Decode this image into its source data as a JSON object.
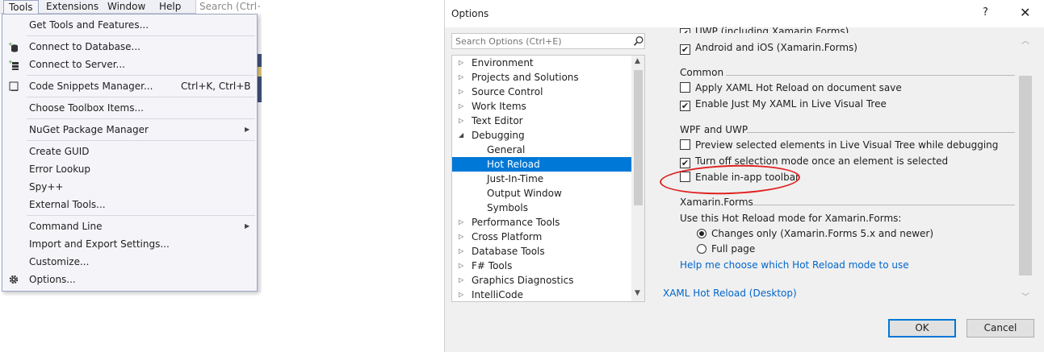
{
  "menubar": {
    "items": [
      "Tools",
      "Extensions",
      "Window",
      "Help"
    ],
    "search_placeholder": "Search (Ctrl+Q)"
  },
  "tools_menu": {
    "items": [
      {
        "label": "Get Tools and Features...",
        "shortcut": "",
        "icon": "",
        "submenu": false
      },
      {
        "label": "Connect to Database...",
        "shortcut": "",
        "icon": "database-plus-icon",
        "submenu": false
      },
      {
        "label": "Connect to Server...",
        "shortcut": "",
        "icon": "server-plus-icon",
        "submenu": false
      },
      {
        "label": "Code Snippets Manager...",
        "shortcut": "Ctrl+K, Ctrl+B",
        "icon": "snippet-icon",
        "submenu": false
      },
      {
        "label": "Choose Toolbox Items...",
        "shortcut": "",
        "icon": "",
        "submenu": false
      },
      {
        "label": "NuGet Package Manager",
        "shortcut": "",
        "icon": "",
        "submenu": true
      },
      {
        "label": "Create GUID",
        "shortcut": "",
        "icon": "",
        "submenu": false
      },
      {
        "label": "Error Lookup",
        "shortcut": "",
        "icon": "",
        "submenu": false
      },
      {
        "label": "Spy++",
        "shortcut": "",
        "icon": "",
        "submenu": false
      },
      {
        "label": "External Tools...",
        "shortcut": "",
        "icon": "",
        "submenu": false
      },
      {
        "label": "Command Line",
        "shortcut": "",
        "icon": "",
        "submenu": true
      },
      {
        "label": "Import and Export Settings...",
        "shortcut": "",
        "icon": "",
        "submenu": false
      },
      {
        "label": "Customize...",
        "shortcut": "",
        "icon": "",
        "submenu": false
      },
      {
        "label": "Options...",
        "shortcut": "",
        "icon": "gear-icon",
        "submenu": false
      }
    ]
  },
  "dialog": {
    "title": "Options",
    "help": "?",
    "close": "✕",
    "search_placeholder": "Search Options (Ctrl+E)",
    "tree": [
      {
        "label": "Environment",
        "level": 0,
        "state": "collapsed",
        "selected": false
      },
      {
        "label": "Projects and Solutions",
        "level": 0,
        "state": "collapsed",
        "selected": false
      },
      {
        "label": "Source Control",
        "level": 0,
        "state": "collapsed",
        "selected": false
      },
      {
        "label": "Work Items",
        "level": 0,
        "state": "collapsed",
        "selected": false
      },
      {
        "label": "Text Editor",
        "level": 0,
        "state": "collapsed",
        "selected": false
      },
      {
        "label": "Debugging",
        "level": 0,
        "state": "expanded",
        "selected": false
      },
      {
        "label": "General",
        "level": 1,
        "state": "leaf",
        "selected": false
      },
      {
        "label": "Hot Reload",
        "level": 1,
        "state": "leaf",
        "selected": true
      },
      {
        "label": "Just-In-Time",
        "level": 1,
        "state": "leaf",
        "selected": false
      },
      {
        "label": "Output Window",
        "level": 1,
        "state": "leaf",
        "selected": false
      },
      {
        "label": "Symbols",
        "level": 1,
        "state": "leaf",
        "selected": false
      },
      {
        "label": "Performance Tools",
        "level": 0,
        "state": "collapsed",
        "selected": false
      },
      {
        "label": "Cross Platform",
        "level": 0,
        "state": "collapsed",
        "selected": false
      },
      {
        "label": "Database Tools",
        "level": 0,
        "state": "collapsed",
        "selected": false
      },
      {
        "label": "F# Tools",
        "level": 0,
        "state": "collapsed",
        "selected": false
      },
      {
        "label": "Graphics Diagnostics",
        "level": 0,
        "state": "collapsed",
        "selected": false
      },
      {
        "label": "IntelliCode",
        "level": 0,
        "state": "collapsed",
        "selected": false
      }
    ],
    "content": {
      "top_partial": {
        "label": "UWP (including Xamarin.Forms)",
        "checked": true
      },
      "top_android": {
        "label": "Android and iOS (Xamarin.Forms)",
        "checked": true
      },
      "common": {
        "heading": "Common",
        "options": [
          {
            "label": "Apply XAML Hot Reload on document save",
            "checked": false
          },
          {
            "label": "Enable Just My XAML in Live Visual Tree",
            "checked": true
          }
        ]
      },
      "wpf_uwp": {
        "heading": "WPF and UWP",
        "options": [
          {
            "label": "Preview selected elements in Live Visual Tree while debugging",
            "checked": false
          },
          {
            "label": "Turn off selection mode once an element is selected",
            "checked": true
          },
          {
            "label": "Enable in-app toolbar",
            "checked": false
          }
        ]
      },
      "xamarin": {
        "heading": "Xamarin.Forms",
        "mode_label": "Use this Hot Reload mode for Xamarin.Forms:",
        "radios": [
          {
            "label": "Changes only (Xamarin.Forms 5.x and newer)",
            "checked": true
          },
          {
            "label": "Full page",
            "checked": false
          }
        ],
        "help_link": "Help me choose which Hot Reload mode to use"
      },
      "desktop_section": "XAML Hot Reload (Desktop)"
    },
    "buttons": {
      "ok": "OK",
      "cancel": "Cancel"
    }
  },
  "colors": {
    "selection": "#0078d7",
    "link": "#0066cc",
    "annotation": "#e02020",
    "menu_bg": "#f5f5f9"
  }
}
